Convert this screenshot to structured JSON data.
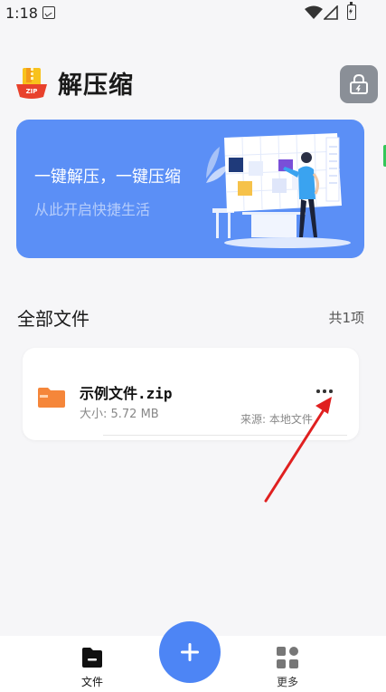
{
  "status_bar": {
    "time": "1:18",
    "icons": [
      "notification-icon",
      "wifi-icon",
      "signal-icon",
      "battery-charging-icon"
    ]
  },
  "header": {
    "title": "解压缩",
    "logo_icon": "zip-app-logo",
    "logo_text": "ZIP",
    "lock_icon": "lock-icon"
  },
  "banner": {
    "headline": "一键解压，一键压缩",
    "subtitle": "从此开启快捷生活",
    "background": "#5b8ff6"
  },
  "section": {
    "title": "全部文件",
    "count": "共1项"
  },
  "files": [
    {
      "name": "示例文件.zip",
      "size": "大小: 5.72 MB",
      "source": "来源: 本地文件",
      "icon": "folder-icon",
      "icon_color": "#f5863a"
    }
  ],
  "bottom_nav": {
    "items": [
      {
        "label": "文件",
        "icon": "folder-tab-icon",
        "active": true
      },
      {
        "label": "更多",
        "icon": "grid-icon",
        "active": false
      }
    ],
    "fab_icon": "plus-icon",
    "fab_color": "#4d85f5"
  },
  "colors": {
    "accent": "#4d85f5",
    "annotation": "#e02020",
    "lock_button": "#8a8f97"
  }
}
